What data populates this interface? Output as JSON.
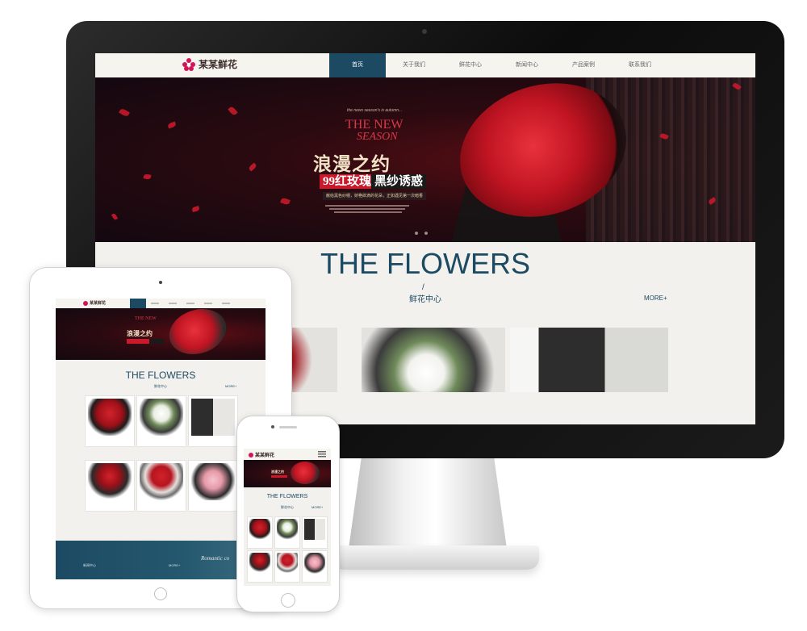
{
  "brand": {
    "name": "某某鲜花",
    "accent": "#1d4a63",
    "logo_color": "#d4145a",
    "highlight": "#c81a2a"
  },
  "nav": {
    "items": [
      {
        "label": "首页"
      },
      {
        "label": "关于我们"
      },
      {
        "label": "鲜花中心"
      },
      {
        "label": "新闻中心"
      },
      {
        "label": "产品案例"
      },
      {
        "label": "联系我们"
      }
    ]
  },
  "banner": {
    "subtitle": "the news season's is autumn...",
    "season_line1": "THE NEW",
    "season_line2": "SEASON",
    "title": "浪漫之约",
    "tag_red": "99红玫瑰",
    "tag_dark": "黑纱诱惑",
    "tagline": "献给黑色纱幔，娇艳欲滴的花朵，正如遇见第一次暗香"
  },
  "flowers_section": {
    "title": "THE FLOWERS",
    "divider": "/",
    "subtitle": "鲜花中心",
    "more": "MORE+"
  },
  "tablet": {
    "footer_label": "新闻中心",
    "footer_more": "MORE+",
    "footer_romantic": "Romantic co"
  }
}
